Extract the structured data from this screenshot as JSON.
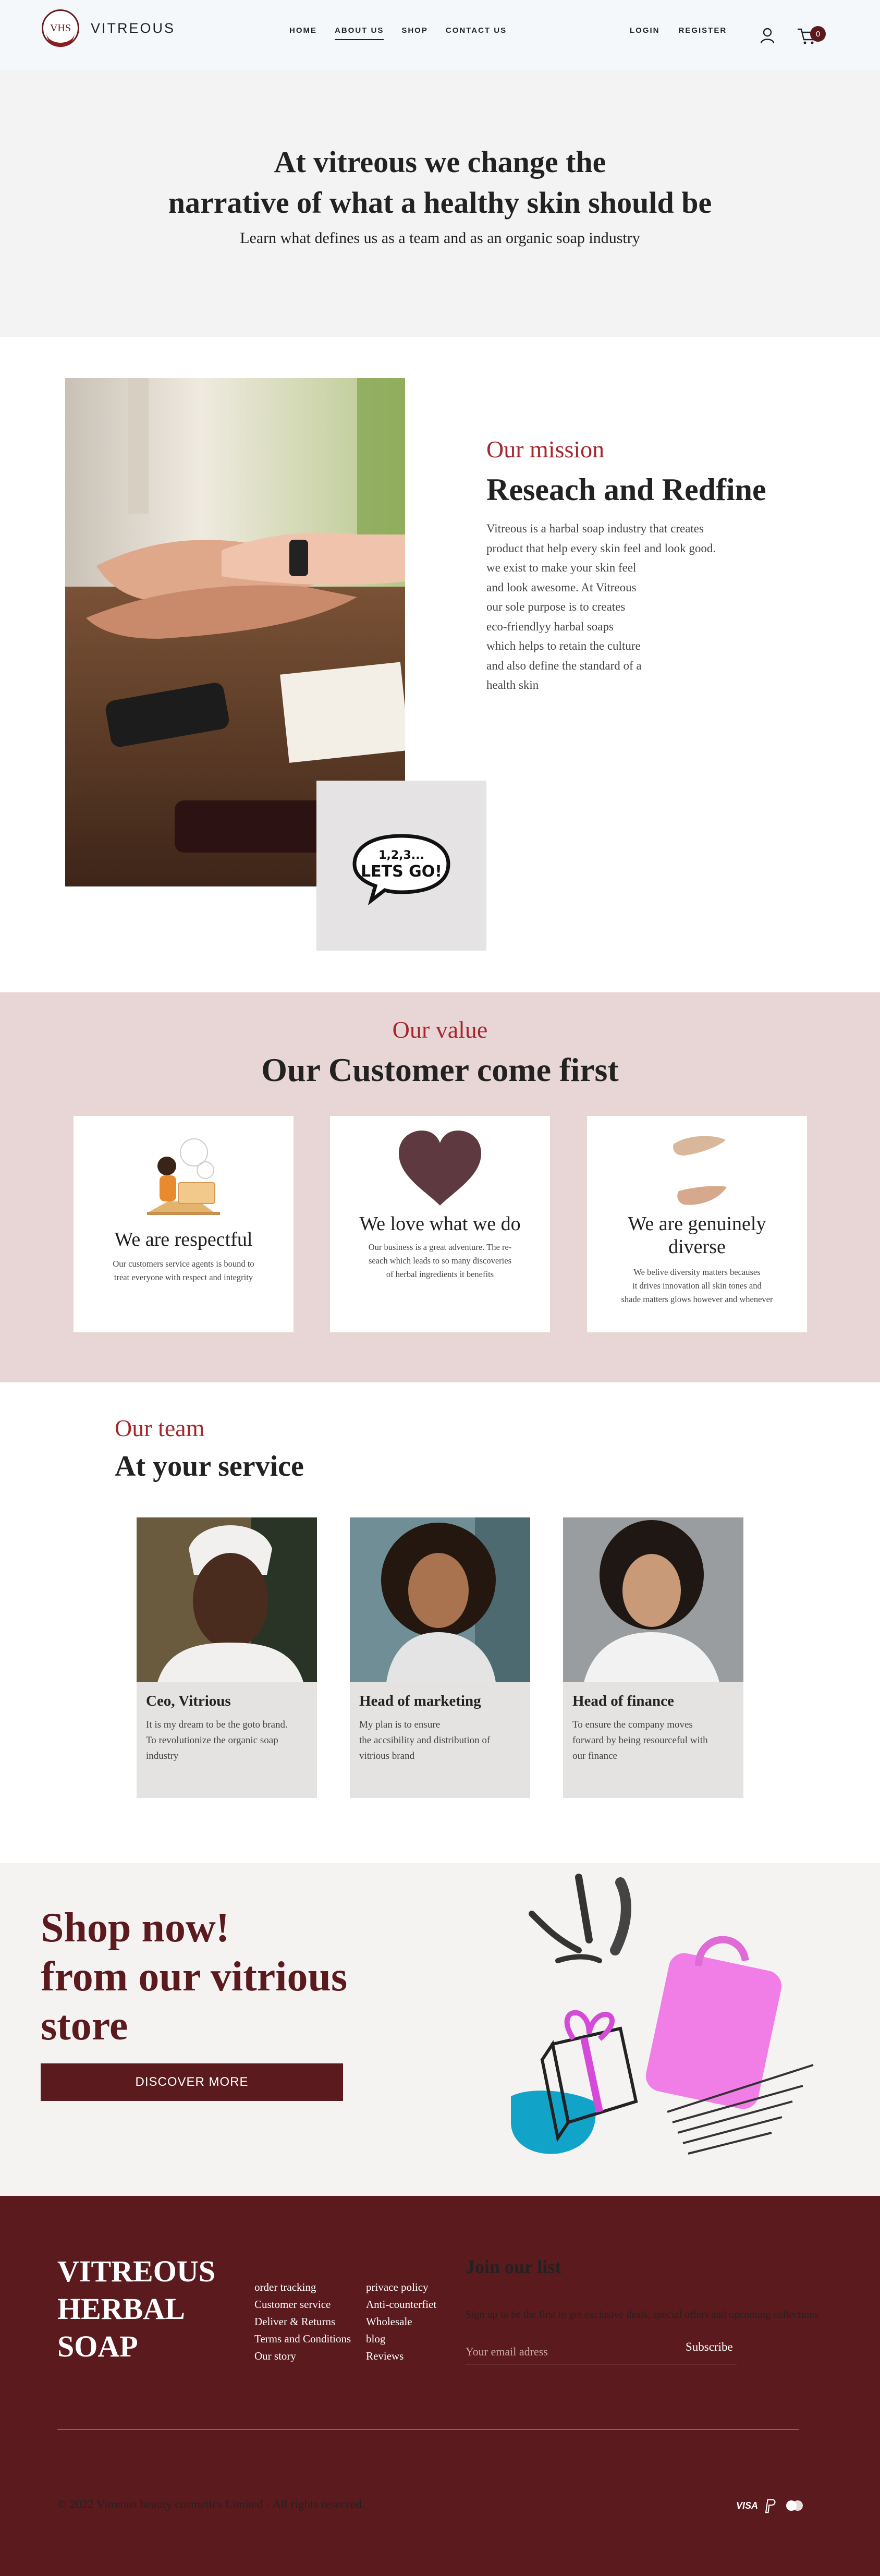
{
  "colors": {
    "accent": "#a5262d",
    "brand_dark": "#5b1a1e",
    "hero_bg": "#f3f3f3",
    "values_bg": "#e8d6d7",
    "header_bg": "#f4f8fb"
  },
  "header": {
    "logo_text": "VHS",
    "brand": "VITREOUS",
    "nav": [
      "HOME",
      "ABOUT US",
      "SHOP",
      "CONTACT US"
    ],
    "active_nav": "ABOUT US",
    "login": "LOGIN",
    "register": "REGISTER",
    "cart_count": "0"
  },
  "hero": {
    "title_line1": "At vitreous we change the",
    "title_line2": "narrative of what a healthy skin should be",
    "subtitle": "Learn what defines us as a team and as an organic soap industry"
  },
  "mission": {
    "label": "Our mission",
    "title": "Reseach and Redfine",
    "lines": [
      "Vitreous is a harbal soap industry that creates",
      "product that help every skin feel and look good.",
      "we exist to make your skin feel",
      "and look awesome. At Vitreous",
      "our sole purpose is to creates",
      "eco-friendlyy harbal soaps",
      "which helps to retain the culture",
      "and also define the standard of a",
      "health skin"
    ],
    "sticker_top": "1,2,3...",
    "sticker_bottom": "LETS GO!"
  },
  "values": {
    "label": "Our value",
    "title": "Our Customer come first",
    "cards": [
      {
        "title": "We are respectful",
        "lines": [
          "Our customers service agents is bound to",
          "treat everyone with respect and integrity"
        ],
        "icon": "customer-service-illustration-icon"
      },
      {
        "title": "We love what we do",
        "lines": [
          "Our business is a great adventure. The re-",
          "seach which leads to so many discoveries",
          "of herbal ingredients it benefits"
        ],
        "icon": "heart-icon"
      },
      {
        "title_line1": "We are genuinely",
        "title_line2": "diverse",
        "lines": [
          "We belive diversity matters becauses",
          "it drives innovation all skin tones and",
          "shade matters glows however and whenever"
        ],
        "icon": "skin-tone-swatch-icon"
      }
    ]
  },
  "team": {
    "label": "Our team",
    "title": "At your service",
    "members": [
      {
        "role": "Ceo, Vitrious",
        "lines": [
          "It is my dream to be the goto brand.",
          "To revolutionize the organic soap",
          "industry"
        ]
      },
      {
        "role": "Head of marketing",
        "lines": [
          "My plan is to ensure",
          "the accsibility and distribution of",
          "vitrious brand"
        ]
      },
      {
        "role": "Head of finance",
        "lines": [
          "To ensure the company moves",
          "forward by being resourceful with",
          "our finance"
        ]
      }
    ]
  },
  "shop": {
    "line1": "Shop now!",
    "line2": "from our vitrious",
    "line3": "store",
    "button": "DISCOVER MORE"
  },
  "footer": {
    "brand_line1": "VITREOUS",
    "brand_line2": "HERBAL",
    "brand_line3": "SOAP",
    "col1": [
      "order tracking",
      "Customer service",
      "Deliver & Returns",
      "Terms and Conditions",
      "Our story"
    ],
    "col2": [
      "privace policy",
      "Anti-counterfiet",
      "Wholesale",
      "blog",
      "Reviews"
    ],
    "list_title": "Join our list",
    "list_desc": "Sign up to be the first to get exclusive deals, special offers and upcoming collections",
    "email_placeholder": "Your email adress",
    "subscribe": "Subscribe",
    "copyright": "2022 Vitreous beauty cosmetics Limited - All rights reserved.",
    "payment_visa": "VISA"
  }
}
